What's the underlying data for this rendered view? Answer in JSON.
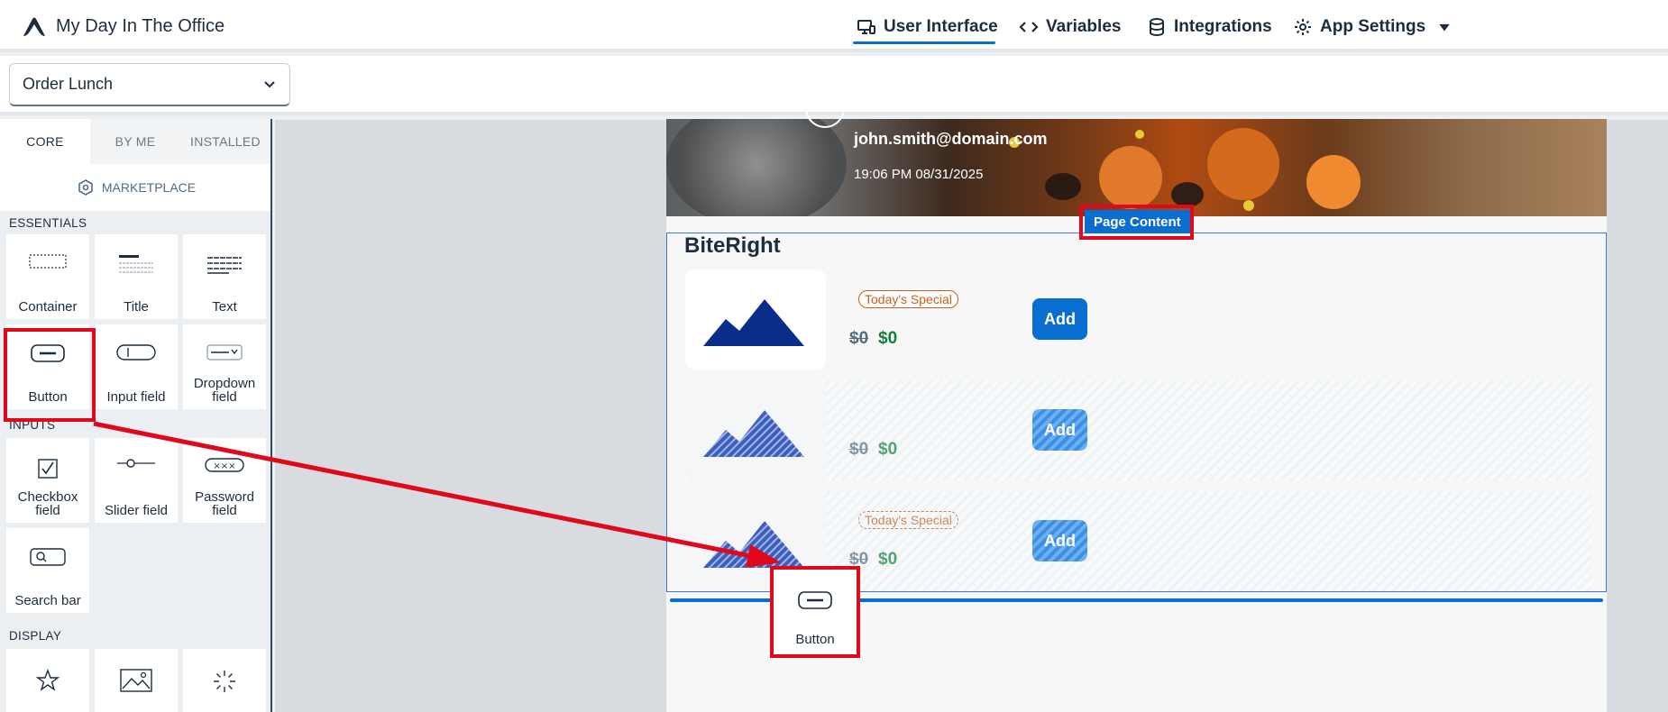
{
  "header": {
    "app_title": "My Day In The Office",
    "nav": {
      "user_interface": "User Interface",
      "variables": "Variables",
      "integrations": "Integrations",
      "app_settings": "App Settings"
    }
  },
  "page_selector": {
    "value": "Order Lunch"
  },
  "left_panel": {
    "tabs": [
      "CORE",
      "BY ME",
      "INSTALLED"
    ],
    "marketplace": "MARKETPLACE",
    "sections": {
      "essentials": "ESSENTIALS",
      "inputs": "INPUTS",
      "display": "DISPLAY"
    },
    "essentials": [
      "Container",
      "Title",
      "Text",
      "Button",
      "Input field",
      "Dropdown field"
    ],
    "inputs": [
      "Checkbox field",
      "Slider field",
      "Password field",
      "Search bar"
    ]
  },
  "canvas": {
    "hero": {
      "email": "john.smith@domain.com",
      "timestamp": "19:06 PM 08/31/2025"
    },
    "page_content_badge": "Page Content",
    "heading": "BiteRight",
    "rows": [
      {
        "badge": "Today's Special",
        "old_price": "$0",
        "new_price": "$0",
        "button": "Add"
      },
      {
        "badge": "",
        "old_price": "$0",
        "new_price": "$0",
        "button": "Add"
      },
      {
        "badge": "Today's Special",
        "old_price": "$0",
        "new_price": "$0",
        "button": "Add"
      }
    ],
    "drag_tile_label": "Button"
  },
  "colors": {
    "accent": "#0a6ed1",
    "highlight_box": "#e0081d",
    "price_green": "#107e3e",
    "badge_orange": "#c8601a"
  }
}
